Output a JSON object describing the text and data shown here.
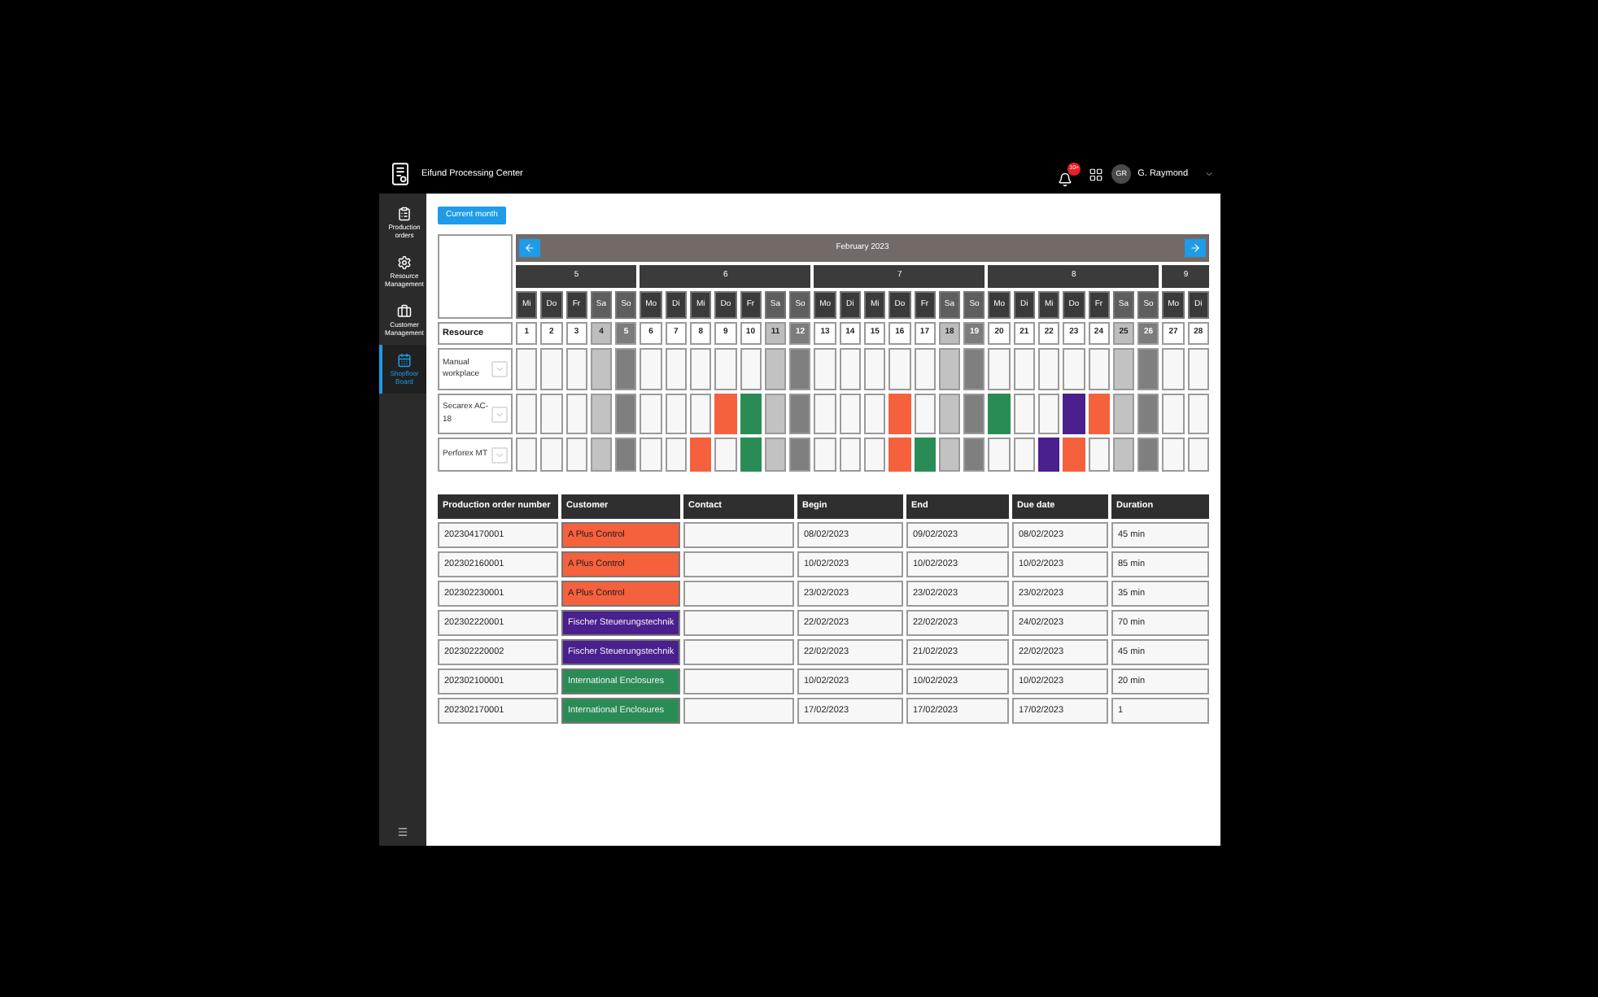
{
  "app": {
    "title": "Eifund Processing Center",
    "notification_count": "10+",
    "user_initials": "GR",
    "user_name": "G. Raymond"
  },
  "sidebar": {
    "items": [
      {
        "label": "Production orders",
        "selected": false
      },
      {
        "label": "Resource Management",
        "selected": false
      },
      {
        "label": "Customer Management",
        "selected": false
      },
      {
        "label": "Shopfloor Board",
        "selected": true
      }
    ]
  },
  "current_month_button": "Current month",
  "calendar": {
    "month": "February 2023",
    "corner_label": "Resource",
    "weeks": [
      {
        "label": "5",
        "days": [
          {
            "weekday": "Mi",
            "date": "1",
            "kind": "workday"
          },
          {
            "weekday": "Do",
            "date": "2",
            "kind": "workday"
          },
          {
            "weekday": "Fr",
            "date": "3",
            "kind": "workday"
          },
          {
            "weekday": "Sa",
            "date": "4",
            "kind": "saturday"
          },
          {
            "weekday": "So",
            "date": "5",
            "kind": "sunday"
          }
        ]
      },
      {
        "label": "6",
        "days": [
          {
            "weekday": "Mo",
            "date": "6",
            "kind": "workday"
          },
          {
            "weekday": "Di",
            "date": "7",
            "kind": "workday"
          },
          {
            "weekday": "Mi",
            "date": "8",
            "kind": "workday"
          },
          {
            "weekday": "Do",
            "date": "9",
            "kind": "workday"
          },
          {
            "weekday": "Fr",
            "date": "10",
            "kind": "workday"
          },
          {
            "weekday": "Sa",
            "date": "11",
            "kind": "saturday"
          },
          {
            "weekday": "So",
            "date": "12",
            "kind": "sunday"
          }
        ]
      },
      {
        "label": "7",
        "days": [
          {
            "weekday": "Mo",
            "date": "13",
            "kind": "workday"
          },
          {
            "weekday": "Di",
            "date": "14",
            "kind": "workday"
          },
          {
            "weekday": "Mi",
            "date": "15",
            "kind": "workday"
          },
          {
            "weekday": "Do",
            "date": "16",
            "kind": "workday"
          },
          {
            "weekday": "Fr",
            "date": "17",
            "kind": "workday"
          },
          {
            "weekday": "Sa",
            "date": "18",
            "kind": "saturday"
          },
          {
            "weekday": "So",
            "date": "19",
            "kind": "sunday"
          }
        ]
      },
      {
        "label": "8",
        "days": [
          {
            "weekday": "Mo",
            "date": "20",
            "kind": "workday"
          },
          {
            "weekday": "Di",
            "date": "21",
            "kind": "workday"
          },
          {
            "weekday": "Mi",
            "date": "22",
            "kind": "workday"
          },
          {
            "weekday": "Do",
            "date": "23",
            "kind": "workday"
          },
          {
            "weekday": "Fr",
            "date": "24",
            "kind": "workday"
          },
          {
            "weekday": "Sa",
            "date": "25",
            "kind": "saturday"
          },
          {
            "weekday": "So",
            "date": "26",
            "kind": "sunday"
          }
        ]
      },
      {
        "label": "9",
        "days": [
          {
            "weekday": "Mo",
            "date": "27",
            "kind": "workday"
          },
          {
            "weekday": "Di",
            "date": "28",
            "kind": "workday"
          }
        ]
      }
    ],
    "resources": [
      {
        "name": "Manual workplace",
        "cells": [
          {
            "booked": false
          },
          {
            "booked": false
          },
          {
            "booked": false
          },
          {
            "booked": false
          },
          {
            "booked": false
          },
          {
            "booked": false
          },
          {
            "booked": false
          },
          {
            "booked": false
          },
          {
            "booked": false
          },
          {
            "booked": false
          },
          {
            "booked": false
          },
          {
            "booked": false
          },
          {
            "booked": false
          },
          {
            "booked": false
          },
          {
            "booked": false
          },
          {
            "booked": false
          },
          {
            "booked": false
          },
          {
            "booked": false
          },
          {
            "booked": false
          },
          {
            "booked": false
          },
          {
            "booked": false
          },
          {
            "booked": false
          },
          {
            "booked": false
          },
          {
            "booked": false
          },
          {
            "booked": false
          },
          {
            "booked": false
          },
          {
            "booked": false
          },
          {
            "booked": false
          }
        ]
      },
      {
        "name": "Secarex AC-18",
        "cells": [
          {
            "booked": false
          },
          {
            "booked": false
          },
          {
            "booked": false
          },
          {
            "booked": false
          },
          {
            "booked": false
          },
          {
            "booked": false
          },
          {
            "booked": false
          },
          {
            "booked": false
          },
          {
            "booked": true,
            "color": "#f5603d"
          },
          {
            "booked": true,
            "color": "#2a8c55"
          },
          {
            "booked": false
          },
          {
            "booked": false
          },
          {
            "booked": false
          },
          {
            "booked": false
          },
          {
            "booked": false
          },
          {
            "booked": true,
            "color": "#f5603d"
          },
          {
            "booked": false
          },
          {
            "booked": false
          },
          {
            "booked": false
          },
          {
            "booked": true,
            "color": "#2a8c55"
          },
          {
            "booked": false
          },
          {
            "booked": false
          },
          {
            "booked": true,
            "color": "#4a1f8e"
          },
          {
            "booked": true,
            "color": "#f5603d"
          },
          {
            "booked": false
          },
          {
            "booked": false
          },
          {
            "booked": false
          },
          {
            "booked": false
          }
        ]
      },
      {
        "name": "Perforex MT",
        "cells": [
          {
            "booked": false
          },
          {
            "booked": false
          },
          {
            "booked": false
          },
          {
            "booked": false
          },
          {
            "booked": false
          },
          {
            "booked": false
          },
          {
            "booked": false
          },
          {
            "booked": true,
            "color": "#f5603d"
          },
          {
            "booked": false
          },
          {
            "booked": true,
            "color": "#2a8c55"
          },
          {
            "booked": false
          },
          {
            "booked": false
          },
          {
            "booked": false
          },
          {
            "booked": false
          },
          {
            "booked": false
          },
          {
            "booked": true,
            "color": "#f5603d"
          },
          {
            "booked": true,
            "color": "#2a8c55"
          },
          {
            "booked": false
          },
          {
            "booked": false
          },
          {
            "booked": false
          },
          {
            "booked": false
          },
          {
            "booked": true,
            "color": "#4a1f8e"
          },
          {
            "booked": true,
            "color": "#f5603d"
          },
          {
            "booked": false
          },
          {
            "booked": false
          },
          {
            "booked": false
          },
          {
            "booked": false
          },
          {
            "booked": false
          }
        ]
      }
    ]
  },
  "table": {
    "columns": [
      "Production order number",
      "Customer",
      "Contact",
      "Begin",
      "End",
      "Due date",
      "Duration"
    ],
    "rows": [
      {
        "order_number": "202304170001",
        "customer": "A Plus Control",
        "color": "#f5603d",
        "begin": "08/02/2023",
        "end": "09/02/2023",
        "due_date": "08/02/2023",
        "duration": "45 min"
      },
      {
        "order_number": "202302160001",
        "customer": "A Plus Control",
        "color": "#f5603d",
        "begin": "10/02/2023",
        "end": "10/02/2023",
        "due_date": "10/02/2023",
        "duration": "85 min"
      },
      {
        "order_number": "202302230001",
        "customer": "A Plus Control",
        "color": "#f5603d",
        "begin": "23/02/2023",
        "end": "23/02/2023",
        "due_date": "23/02/2023",
        "duration": "35 min"
      },
      {
        "order_number": "202302220001",
        "customer": "Fischer Steuerungstechnik",
        "color": "#4a1f8e",
        "begin": "22/02/2023",
        "end": "22/02/2023",
        "due_date": "24/02/2023",
        "duration": "70 min"
      },
      {
        "order_number": "202302220002",
        "customer": "Fischer Steuerungstechnik",
        "color": "#4a1f8e",
        "begin": "22/02/2023",
        "end": "21/02/2023",
        "due_date": "22/02/2023",
        "duration": "45 min"
      },
      {
        "order_number": "202302100001",
        "customer": "International Enclosures",
        "color": "#2a8c55",
        "begin": "10/02/2023",
        "end": "10/02/2023",
        "due_date": "10/02/2023",
        "duration": "20 min"
      },
      {
        "order_number": "202302170001",
        "customer": "International Enclosures",
        "color": "#2a8c55",
        "begin": "17/02/2023",
        "end": "17/02/2023",
        "due_date": "17/02/2023",
        "duration": "1"
      }
    ]
  }
}
